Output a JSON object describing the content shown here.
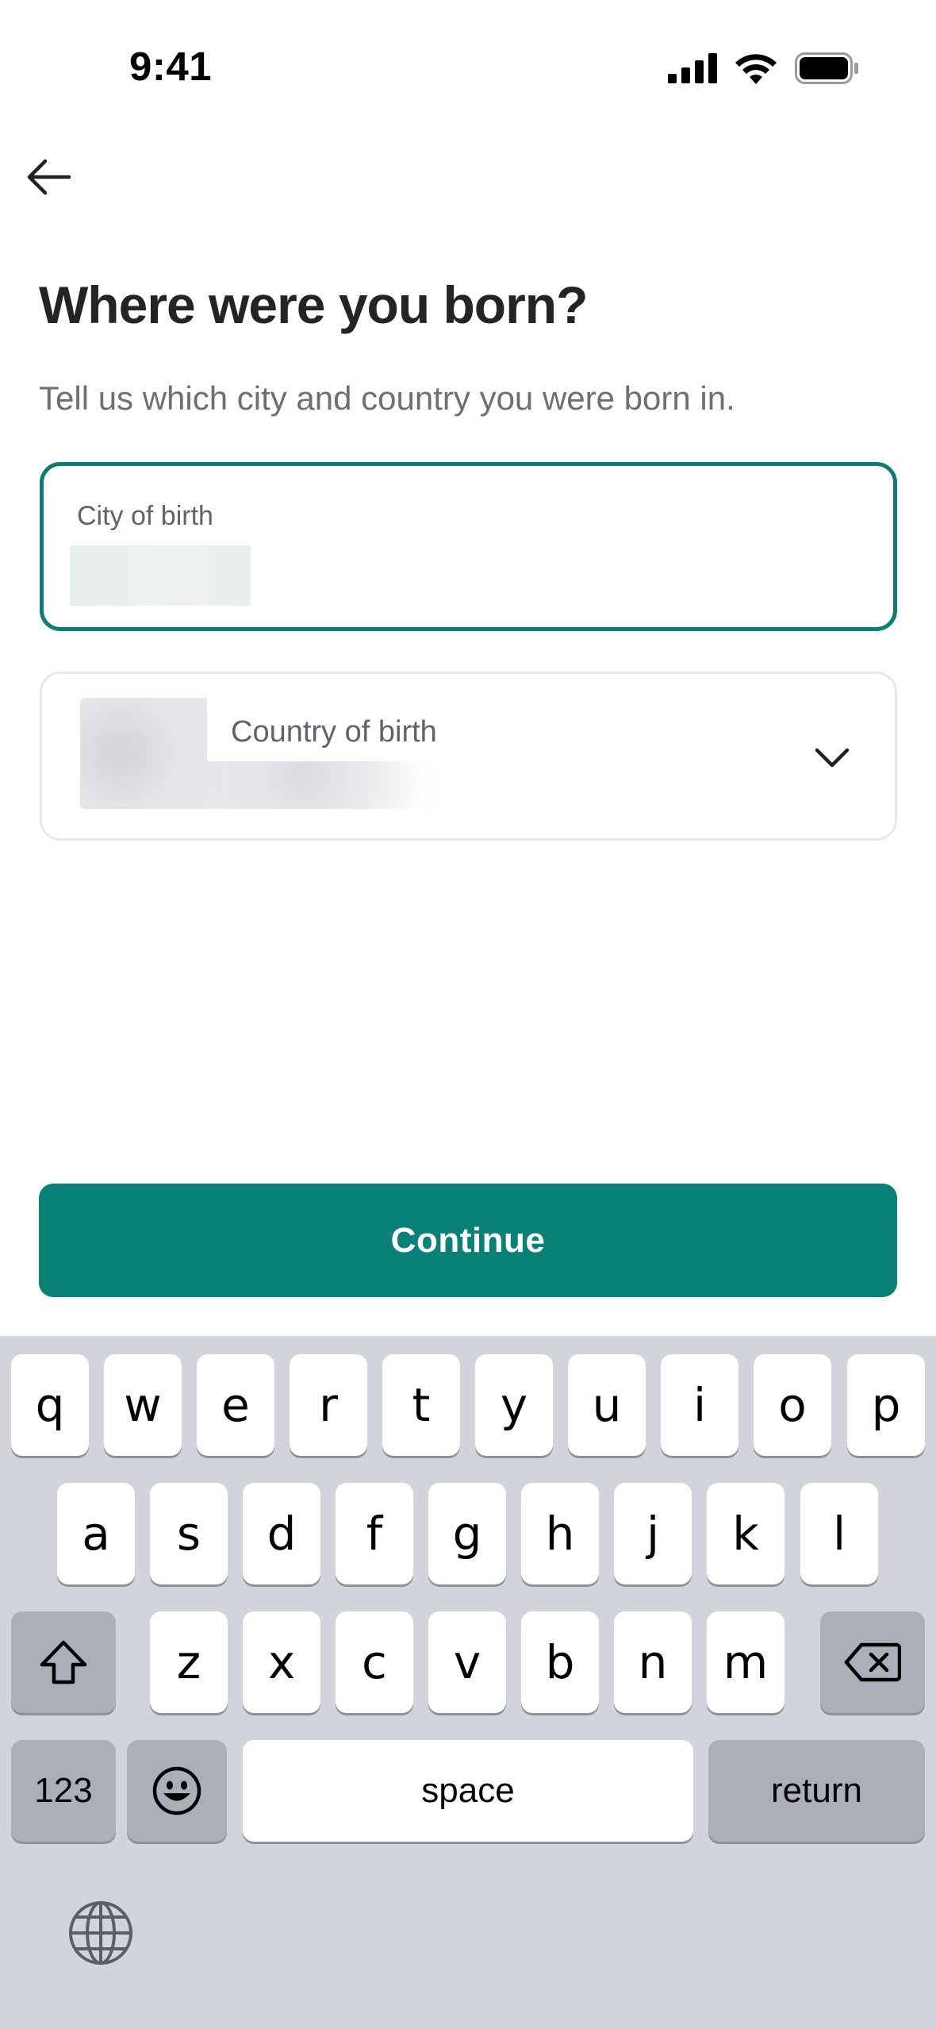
{
  "status_bar": {
    "time": "9:41"
  },
  "header": {
    "title": "Where were you born?",
    "subtitle": "Tell us which city and country you were born in."
  },
  "form": {
    "city_label": "City of birth",
    "country_label": "Country of birth"
  },
  "actions": {
    "continue_label": "Continue"
  },
  "keyboard": {
    "row1": [
      "q",
      "w",
      "e",
      "r",
      "t",
      "y",
      "u",
      "i",
      "o",
      "p"
    ],
    "row2": [
      "a",
      "s",
      "d",
      "f",
      "g",
      "h",
      "j",
      "k",
      "l"
    ],
    "row3": [
      "z",
      "x",
      "c",
      "v",
      "b",
      "n",
      "m"
    ],
    "numbers_label": "123",
    "space_label": "space",
    "return_label": "return"
  },
  "colors": {
    "accent": "#0a8176",
    "keyboard_bg": "#d1d4db"
  }
}
